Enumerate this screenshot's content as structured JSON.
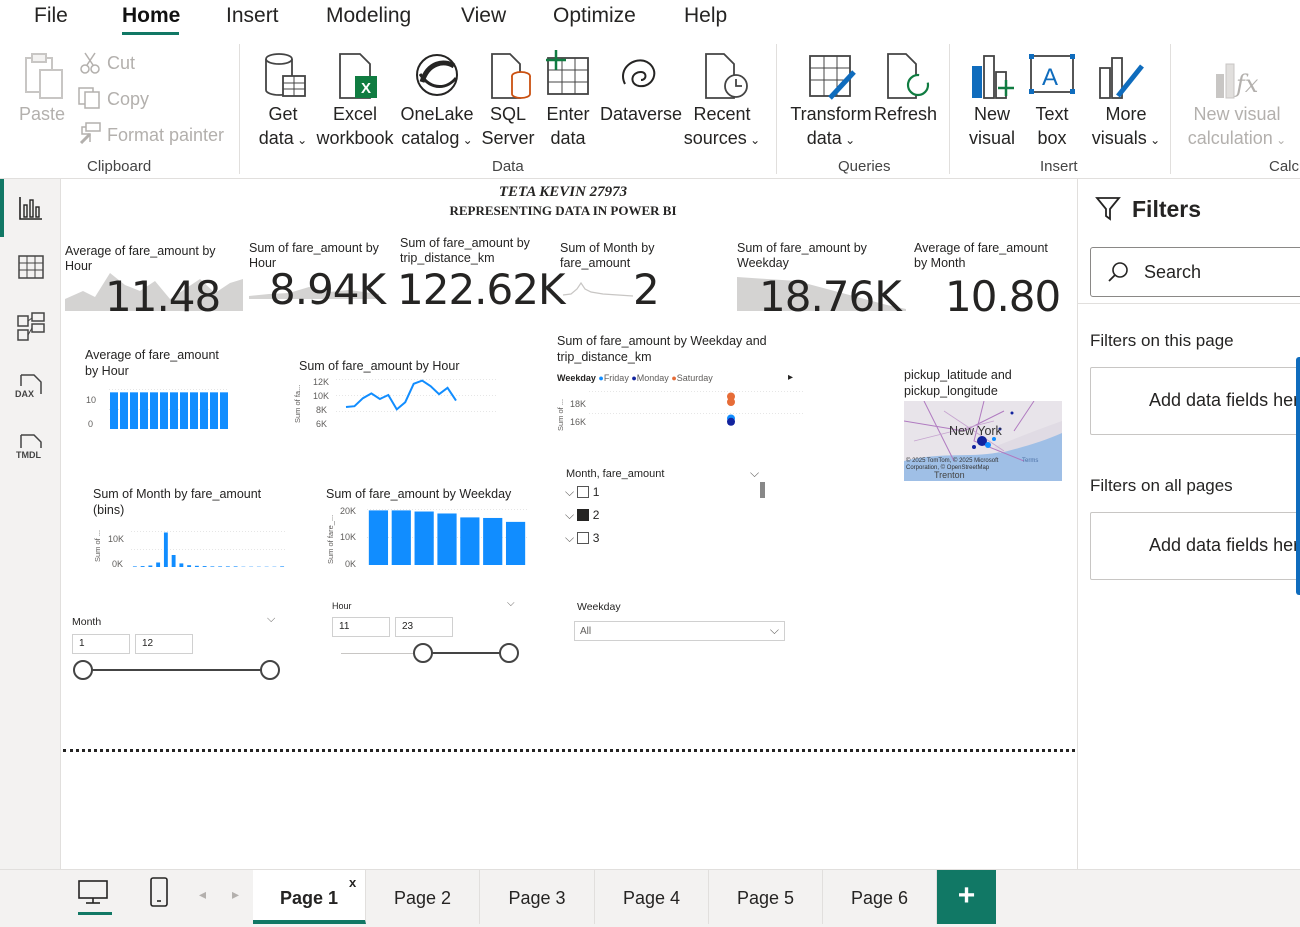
{
  "menu": {
    "items": [
      "File",
      "Home",
      "Insert",
      "Modeling",
      "View",
      "Optimize",
      "Help"
    ],
    "active": "Home"
  },
  "ribbon": {
    "paste": "Paste",
    "cut": "Cut",
    "copy": "Copy",
    "format_painter": "Format painter",
    "get_data": [
      "Get",
      "data"
    ],
    "excel": [
      "Excel",
      "workbook"
    ],
    "onelake": [
      "OneLake",
      "catalog"
    ],
    "sql": [
      "SQL",
      "Server"
    ],
    "enter_data": [
      "Enter",
      "data"
    ],
    "dataverse": "Dataverse",
    "recent": [
      "Recent",
      "sources"
    ],
    "transform": [
      "Transform",
      "data"
    ],
    "refresh": "Refresh",
    "new_visual": [
      "New",
      "visual"
    ],
    "text_box": [
      "Text",
      "box"
    ],
    "more_visuals": [
      "More",
      "visuals"
    ],
    "new_visual_calc": [
      "New visual",
      "calculation"
    ],
    "groups": {
      "clipboard": "Clipboard",
      "data": "Data",
      "queries": "Queries",
      "insert": "Insert",
      "calc": "Calcu"
    }
  },
  "leftnav": {
    "dax": "DAX",
    "tmdl": "TMDL"
  },
  "report": {
    "title1": "TETA KEVIN 27973",
    "title2": "REPRESENTING DATA IN POWER BI",
    "cards": [
      {
        "title": "Average of fare_amount by Hour",
        "value": "11.48"
      },
      {
        "title": "Sum of fare_amount by Hour",
        "value": "8.94K"
      },
      {
        "title": "Sum of fare_amount by trip_distance_km",
        "value": "122.62K"
      },
      {
        "title": "Sum of Month by fare_amount",
        "value": "2"
      },
      {
        "title": "Sum of fare_amount by Weekday",
        "value": "18.76K"
      },
      {
        "title": "Average of fare_amount by Month",
        "value": "10.80"
      }
    ],
    "avg_hour": {
      "title": "Average of fare_amount by Hour",
      "y_ticks": [
        "10",
        "0"
      ]
    },
    "sum_hour": {
      "title": "Sum of fare_amount by Hour",
      "y_ticks": [
        "12K",
        "10K",
        "8K",
        "6K"
      ],
      "ylabel": "Sum of fa..."
    },
    "weekday_trip": {
      "title": "Sum of fare_amount by Weekday and trip_distance_km",
      "legend_title": "Weekday",
      "legend": [
        {
          "name": "Friday",
          "color": "#118DFF"
        },
        {
          "name": "Monday",
          "color": "#12239E"
        },
        {
          "name": "Saturday",
          "color": "#E66C37"
        }
      ],
      "y_ticks": [
        "18K",
        "16K"
      ],
      "ylabel": "Sum of ..."
    },
    "map": {
      "title": "pickup_latitude and pickup_longitude",
      "label": "New York",
      "label2": "Trenton",
      "credit": "© 2025 TomTom, © 2025 Microsoft Corporation, © OpenStreetMap",
      "terms": "Terms"
    },
    "month_bins": {
      "title": "Sum of Month by fare_amount (bins)",
      "y_ticks": [
        "10K",
        "0K"
      ],
      "ylabel": "Sum of ..."
    },
    "sum_weekday": {
      "title": "Sum of fare_amount by Weekday",
      "y_ticks": [
        "20K",
        "10K",
        "0K"
      ],
      "ylabel": "Sum of fare_..."
    },
    "month_list": {
      "title": "Month, fare_amount",
      "items": [
        "1",
        "2",
        "3"
      ]
    },
    "slicer_month": {
      "title": "Month",
      "min": "1",
      "max": "12"
    },
    "slicer_hour": {
      "title": "Hour",
      "min": "11",
      "max": "23"
    },
    "slicer_weekday": {
      "title": "Weekday",
      "value": "All"
    }
  },
  "chart_data": [
    {
      "type": "bar",
      "title": "Average of fare_amount by Hour",
      "values": [
        11,
        11,
        11,
        11,
        11,
        11,
        11,
        11,
        11,
        11,
        11,
        11
      ],
      "ylim": [
        0,
        12
      ]
    },
    {
      "type": "line",
      "title": "Sum of fare_amount by Hour",
      "values": [
        8.5,
        8.6,
        9.6,
        10.2,
        9.5,
        10.0,
        8.2,
        9.1,
        11.4,
        11.8,
        11.1,
        10.1,
        10.9,
        9.3
      ],
      "ylim": [
        6,
        12
      ]
    },
    {
      "type": "scatter",
      "title": "Sum of fare_amount by Weekday and trip_distance_km",
      "points": [
        {
          "series": "Saturday",
          "y": 18.5
        },
        {
          "series": "Saturday",
          "y": 18.0
        },
        {
          "series": "Friday",
          "y": 16.5
        },
        {
          "series": "Monday",
          "y": 16.2
        }
      ],
      "ylim": [
        15,
        19
      ]
    },
    {
      "type": "bar",
      "title": "Sum of Month by fare_amount (bins)",
      "values": [
        0.2,
        0.3,
        0.5,
        1.5,
        11.5,
        4,
        1.2,
        0.6,
        0.4,
        0.3,
        0.2,
        0.2,
        0.2,
        0.2,
        0.1,
        0.1,
        0.1,
        0.1,
        0.1,
        0.2
      ],
      "ylim": [
        0,
        12
      ]
    },
    {
      "type": "bar",
      "title": "Sum of fare_amount by Weekday",
      "values": [
        19.5,
        19.5,
        19.1,
        18.4,
        17.0,
        16.8,
        15.4
      ],
      "ylim": [
        0,
        20
      ]
    }
  ],
  "filters": {
    "title": "Filters",
    "search": "Search",
    "this_page": "Filters on this page",
    "all_pages": "Filters on all pages",
    "add_fields": "Add data fields her"
  },
  "tabs": {
    "pages": [
      "Page 1",
      "Page 2",
      "Page 3",
      "Page 4",
      "Page 5",
      "Page 6"
    ],
    "active": "Page 1",
    "close": "x",
    "add": "+"
  }
}
